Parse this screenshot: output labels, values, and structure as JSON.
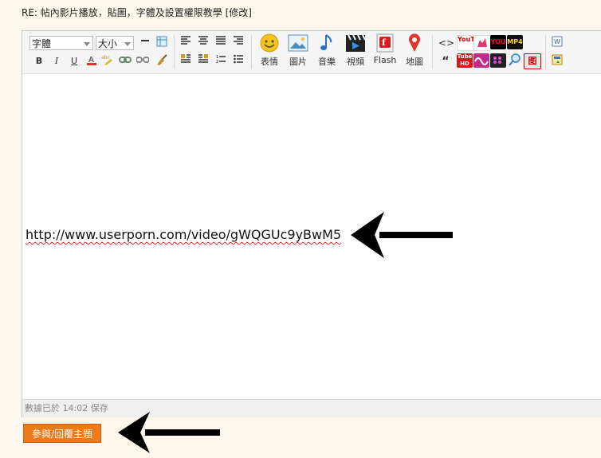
{
  "page": {
    "title": "RE: 帖內影片播放，貼圖，字體及設置權限教學 [修改]"
  },
  "toolbar": {
    "font_select": "字體",
    "size_select": "大小",
    "media_buttons": [
      {
        "label": "表情",
        "icon": "smiley-icon"
      },
      {
        "label": "圖片",
        "icon": "image-icon"
      },
      {
        "label": "音樂",
        "icon": "music-note-icon"
      },
      {
        "label": "視頻",
        "icon": "clapperboard-icon"
      },
      {
        "label": "Flash",
        "icon": "flash-icon"
      },
      {
        "label": "地圖",
        "icon": "map-pin-icon"
      }
    ],
    "site_icons": [
      "YouTube",
      "YOU",
      "MP4",
      "Tube HD",
      "dots",
      "search",
      "?"
    ]
  },
  "editor": {
    "content": "http://www.userporn.com/video/gWQGUc9yBwM5",
    "status": "數據已於 14:02 保存"
  },
  "actions": {
    "submit_label": "參與/回覆主題"
  },
  "colors": {
    "accent": "#f07a1a",
    "arrow": "#000000"
  }
}
